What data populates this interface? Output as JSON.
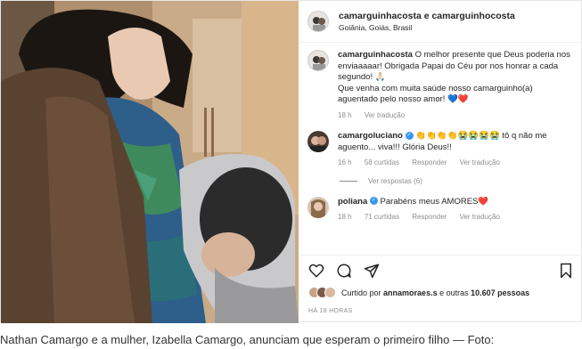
{
  "header": {
    "username": "camarguinhacosta e camarguinhocosta",
    "location": "Goiânia, Goiás, Brasil"
  },
  "caption": {
    "username": "camarguinhacosta",
    "line1": "O melhor presente que Deus poderia nos enviaaaaar! Obrigada Papai do Céu por nos honrar a cada segundo! 🙏🏻",
    "line2": "Que venha com muita saúde nosso camarguinho(a) aguentado pelo nosso amor! 💙❤️",
    "time": "18 h",
    "translate": "Ver tradução"
  },
  "comments": [
    {
      "username": "camargoluciano",
      "text": "👏👏👏👏😭😭😭😭 tô q não me aguento... viva!!! Glória Deus!!",
      "time": "16 h",
      "likes": "58 curtidas",
      "reply": "Responder",
      "translate": "Ver tradução",
      "view_replies": "Ver respostas (6)"
    },
    {
      "username": "poliana",
      "text": "Parabéns meus AMORES❤️",
      "time": "18 h",
      "likes": "71 curtidas",
      "reply": "Responder",
      "translate": "Ver tradução"
    }
  ],
  "likes": {
    "prefix": "Curtido por",
    "user": "annamoraes.s",
    "suffix": "e outras",
    "count": "10.607 pessoas"
  },
  "timestamp": "HÁ 18 HORAS",
  "article_caption": "Nathan Camargo e a mulher, Izabella Camargo, anunciam que esperam o primeiro filho — Foto:",
  "icons": {
    "like": "heart-icon",
    "comment": "comment-icon",
    "share": "share-icon",
    "save": "bookmark-icon"
  }
}
